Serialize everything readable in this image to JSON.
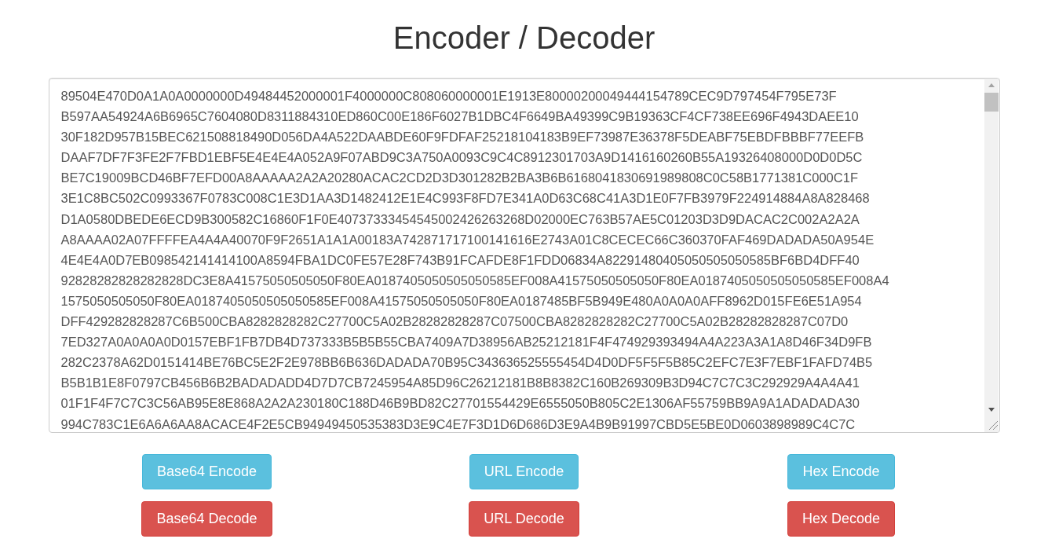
{
  "title": "Encoder / Decoder",
  "text_area": {
    "lines": [
      "89504E470D0A1A0A0000000D49484452000001F4000000C808060000001E1913E80000200049444154789CEC9D797454F795E73F",
      "B597AA54924A6B6965C7604080D8311884310ED860C00E186F6027B1DBC4F6649BA49399C9B19363CF4CF738EE696F4943DAEE10",
      "30F182D957B15BEC621508818490D056DA4A522DAABDE60F9FDFAF25218104183B9EF73987E36378F5DEABF75EBDFBBBF77EEFB",
      "DAAF7DF7F3FE2F7FBD1EBF5E4E4E4A052A9F07ABD9C3A750A0093C9C4C8912301703A9D1416160260B55A19326408000D0D0D5C",
      "BE7C19009BCD46BF7EFD00A8AAAAA2A2A20280ACAC2CD2D3D301282B2BA3B6B6168041830691989808C0C58B1771381C000C1F",
      "3E1C8BC502C0993367F0783C008C1E3D1AA3D1482412E1E4C993F8FD7E341A0D63C68C41A3D1E0F7FB3979F224914884A8A828468",
      "D1A0580DBEDE6ECD9B300582C16860F1F0E40737333454545002426263268D02000EC763B57AE5C01203D3D9DACAC2C002A2A2A",
      "A8AAAA02A07FFFFEA4A4A40070F9F2651A1A1A00183A742871717100141616E2743A01C8CECEC66C360370FAF469DADADA50A954E",
      "4E4E4A0D7EB098542141414100A8594FBA1DC0FE57E28F743B91FCAFDE8F1FDD06834A82291480405050505050585BF6BD4DFF40",
      "92828282828282828DC3E8A41575050505050F80EA0187405050505050585EF008A41575050505050F80EA0187405050505050585EF008A4",
      "1575050505050F80EA0187405050505050585EF008A41575050505050F80EA0187485BF5B949E480A0A0A0AFF8962D015FE6E51A954",
      "DFF429282828287C6B500CBA8282828282C27700C5A02B28282828287C07500CBA8282828282C27700C5A02B28282828287C07D0",
      "7ED327A0A0A0A0D0157EBF1FB7DB4D737333B5B5B55CBA7409A7D38956AB25212181F4F474929393494A4A223A3A1A8D46F34D9FB",
      "282C2378A62D0151414BE76BC5E2F2E978BB6B636DADADA70B95C343636525555454D4D0DF5F5F5B85C2EFC7E3F7EBF1FAFD74B5",
      "B5B1B1E8F0797CB456B6B2BADADADD4D7D7CB7245954A85D96C26212181B8B8382C160B269309B3D94C7C7C3C292929A4A4A41",
      "01F1F4F7C7C3C56AB95E8E868A2A2A230180C188D46B9BD82C27701554429E6555050B805C2E1306AF55759BB9A9A1ADADADA30",
      "994C783C1E6A6A6AA8ACACE4F2E5CB94949450535383D3E9C4E7F3D1D6D686D3E9A4B9B91997CBD5E5BE0D0603898989C4C7C"
    ]
  },
  "actions": [
    {
      "label": "Base64 Encode",
      "kind": "encode"
    },
    {
      "label": "URL Encode",
      "kind": "encode"
    },
    {
      "label": "Hex Encode",
      "kind": "encode"
    },
    {
      "label": "Base64 Decode",
      "kind": "decode"
    },
    {
      "label": "URL Decode",
      "kind": "decode"
    },
    {
      "label": "Hex Decode",
      "kind": "decode"
    }
  ]
}
